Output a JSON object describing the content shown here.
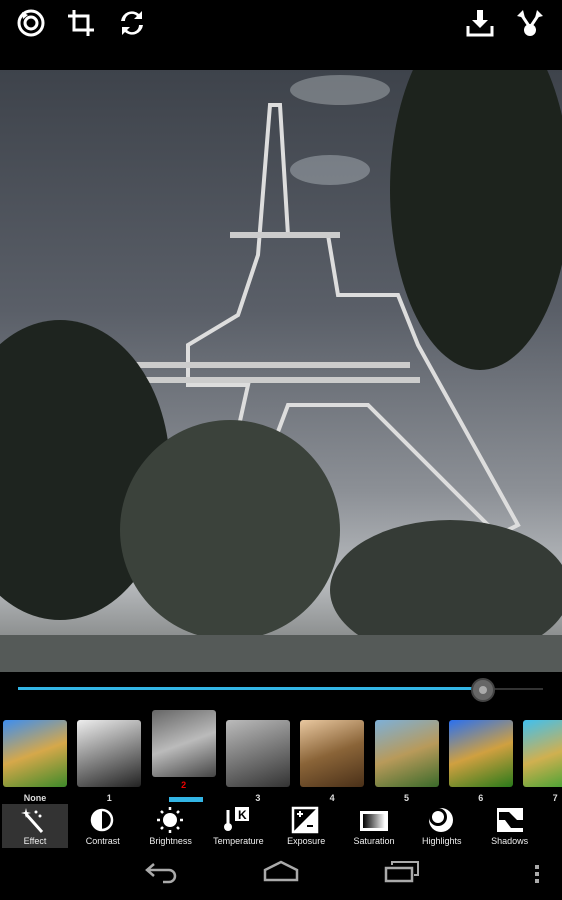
{
  "topbar": {
    "left": [
      "rotate-icon",
      "crop-icon",
      "flip-icon"
    ],
    "right": [
      "save-icon",
      "share-icon"
    ]
  },
  "slider": {
    "value_percent": 88.6
  },
  "filters": [
    {
      "label": "None",
      "bg": "linear-gradient(160deg,#3d8ef0,#d6a84a 50%,#3e8a2a)"
    },
    {
      "label": "1",
      "bg": "linear-gradient(160deg,#eee,#888 50%,#222)"
    },
    {
      "label": "2",
      "bg": "linear-gradient(160deg,#666,#bbb 50%,#444)",
      "selected": true
    },
    {
      "label": "3",
      "bg": "linear-gradient(160deg,#bbb,#777 50%,#333)"
    },
    {
      "label": "4",
      "bg": "linear-gradient(160deg,#e9c8a0,#8a6438 50%,#4a3018)"
    },
    {
      "label": "5",
      "bg": "linear-gradient(160deg,#7db0d8,#b89a5a 50%,#3a6a2a)"
    },
    {
      "label": "6",
      "bg": "linear-gradient(160deg,#2a70f0,#d0a040 50%,#2a7a1a)"
    },
    {
      "label": "7",
      "bg": "linear-gradient(160deg,#40c0f0,#d0b050 50%,#30a030)"
    }
  ],
  "tools": [
    {
      "label": "Effect",
      "icon": "magic-wand-icon",
      "active": true
    },
    {
      "label": "Contrast",
      "icon": "contrast-icon"
    },
    {
      "label": "Brightness",
      "icon": "sun-icon"
    },
    {
      "label": "Temperature",
      "icon": "thermometer-icon"
    },
    {
      "label": "Exposure",
      "icon": "exposure-icon"
    },
    {
      "label": "Saturation",
      "icon": "saturation-icon"
    },
    {
      "label": "Highlights",
      "icon": "highlights-icon"
    },
    {
      "label": "Shadows",
      "icon": "shadows-icon"
    }
  ],
  "nav": [
    "back-icon",
    "home-icon",
    "recents-icon",
    "overflow-menu-icon"
  ]
}
